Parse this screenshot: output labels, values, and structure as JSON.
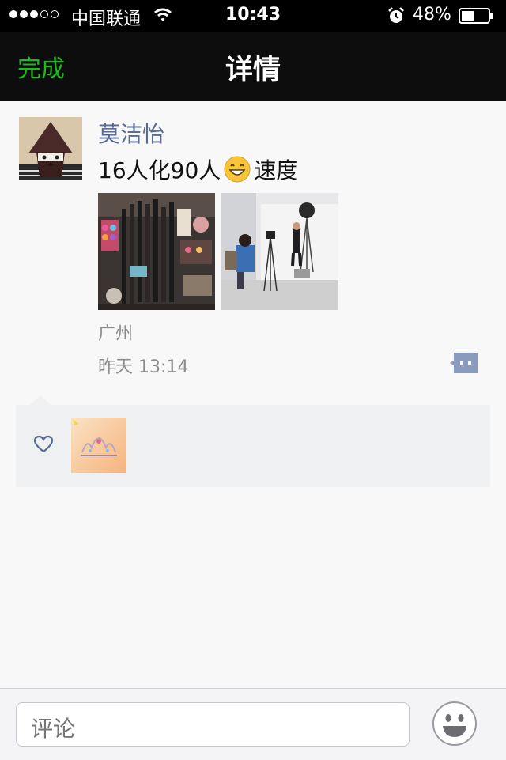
{
  "status_bar": {
    "carrier": "中国联通",
    "time": "10:43",
    "battery": "48%",
    "battery_level": 0.48
  },
  "nav": {
    "done_label": "完成",
    "title": "详情"
  },
  "post": {
    "username": "莫洁怡",
    "text_before_emoji": "16人化90人",
    "emoji": "grinning-face-emoji",
    "text_after_emoji": "速度",
    "location": "广州",
    "timestamp": "昨天 13:14"
  },
  "comment_bar": {
    "placeholder": "评论"
  },
  "colors": {
    "accent_green": "#1dba1d",
    "username_blue": "#576b95",
    "likes_background": "#eff0f2"
  }
}
